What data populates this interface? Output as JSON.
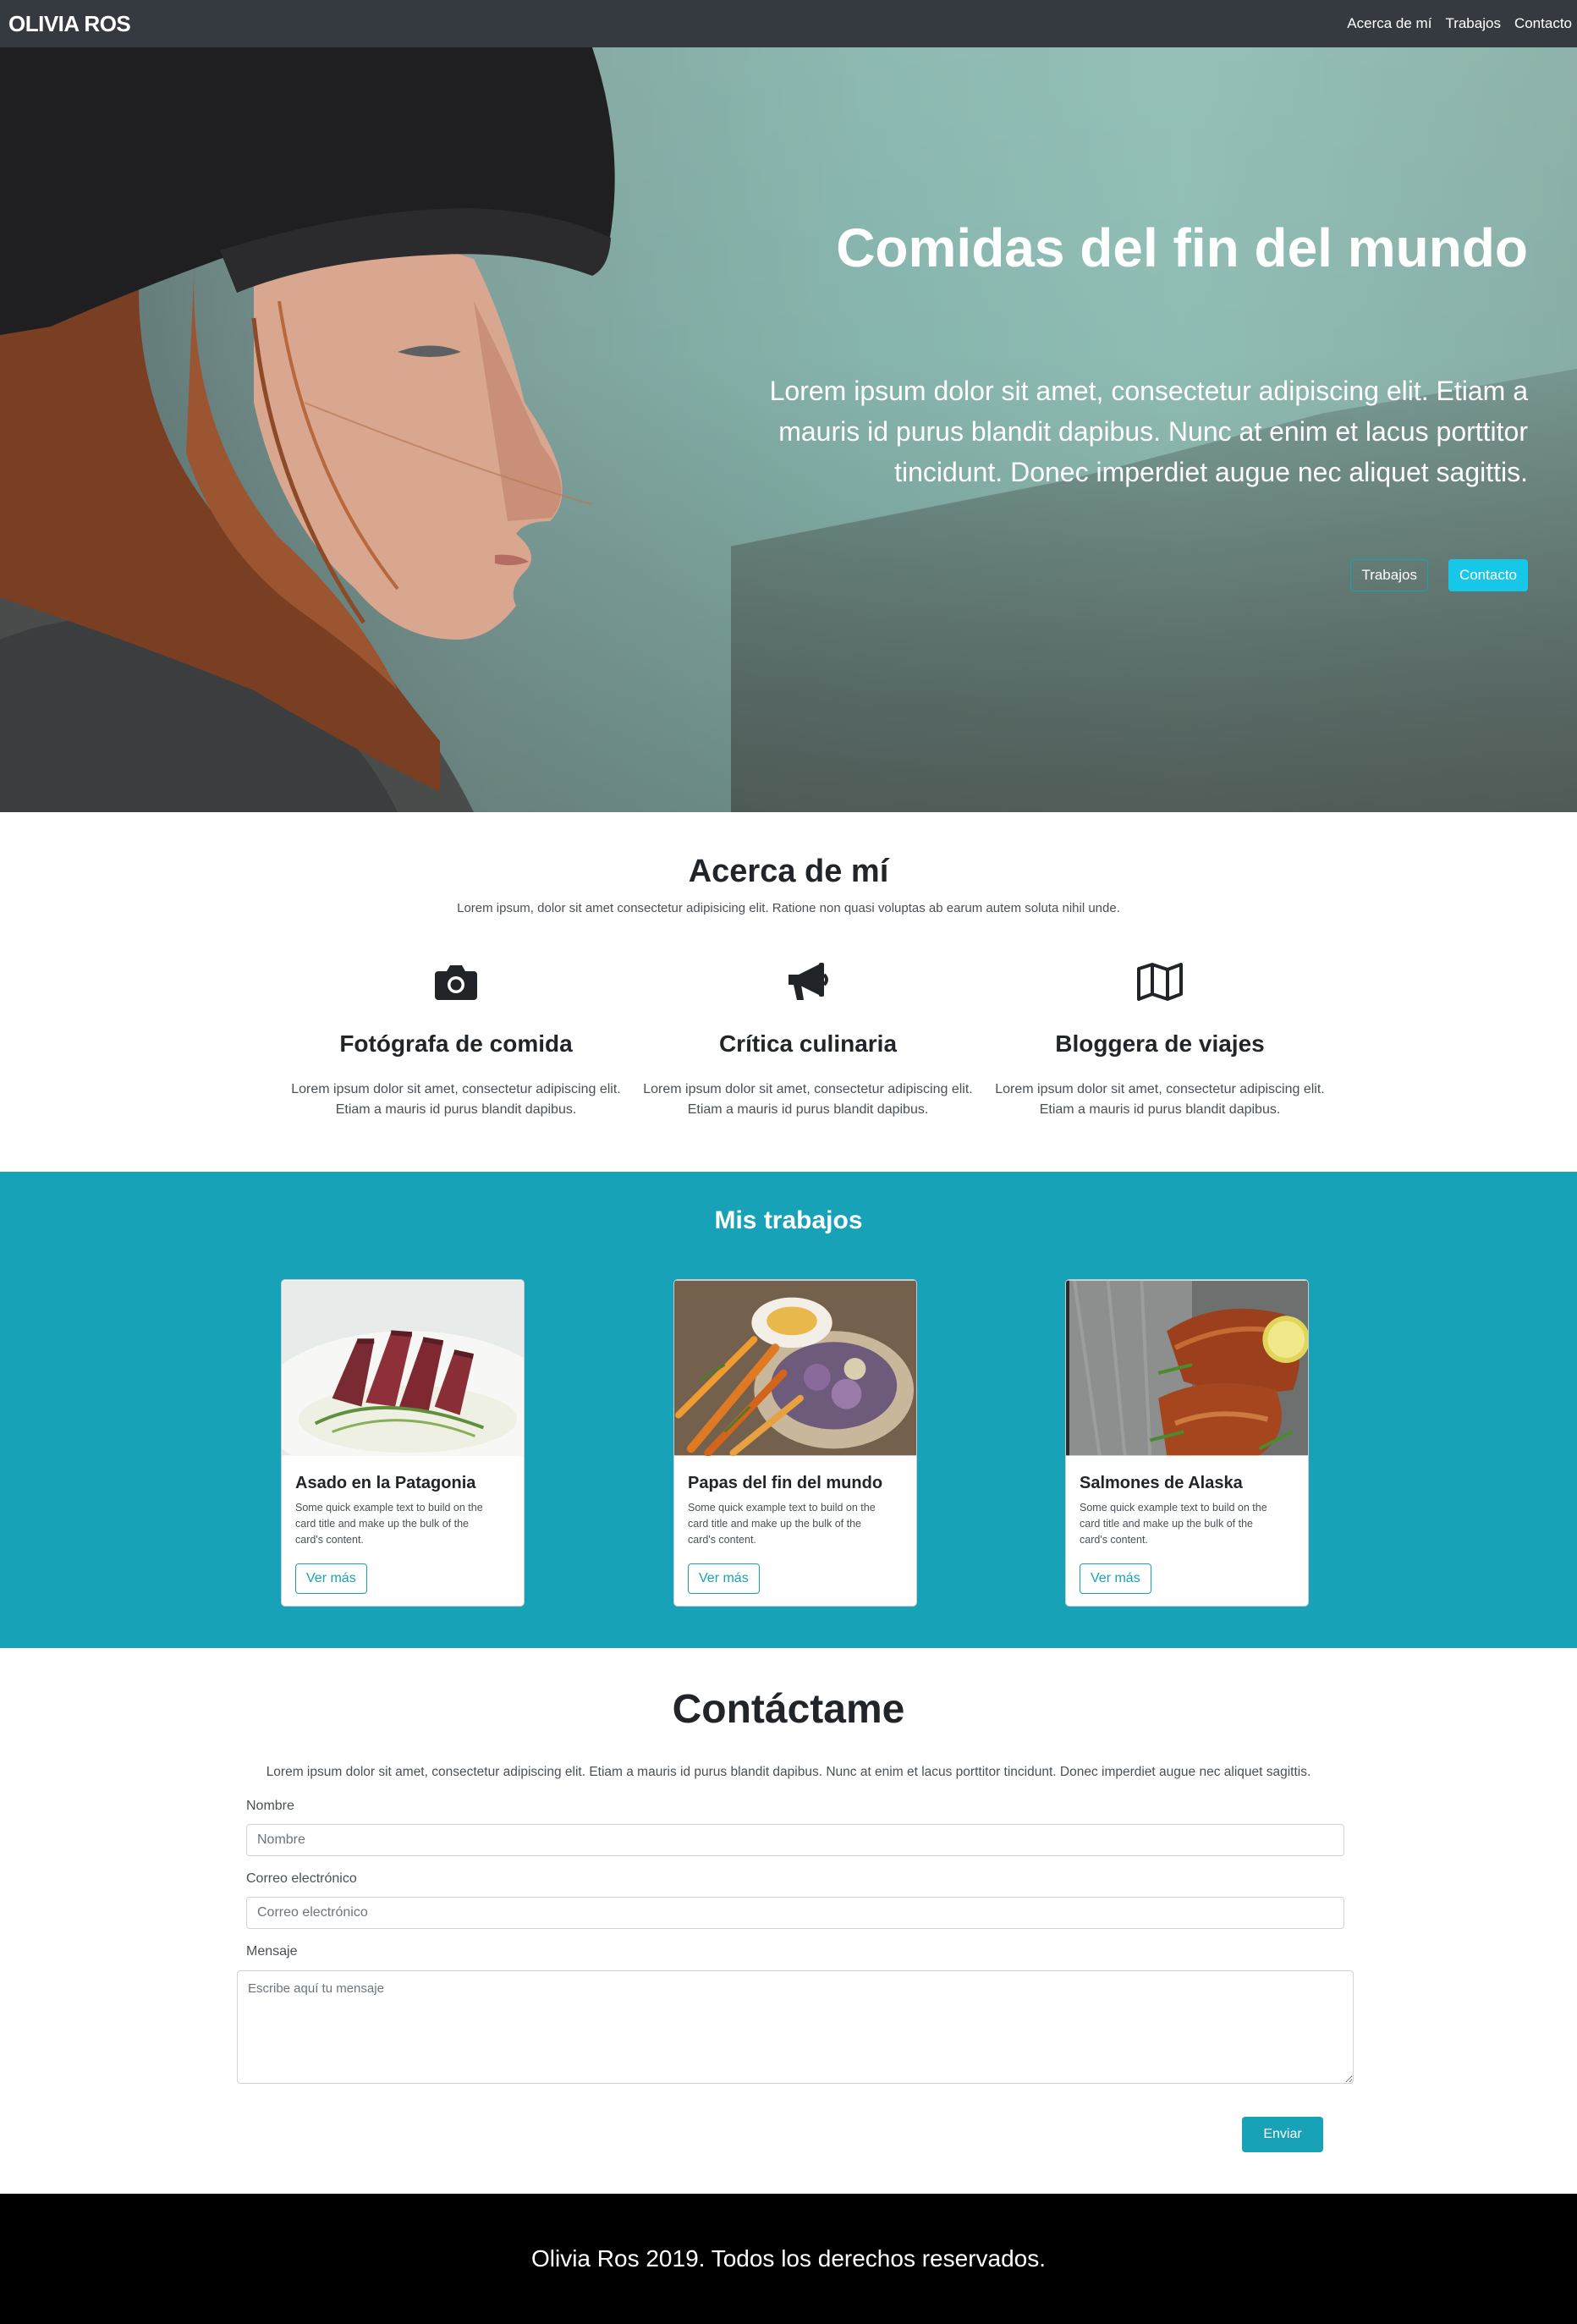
{
  "navbar": {
    "brand": "OLIVIA ROS",
    "links": [
      "Acerca de mí",
      "Trabajos",
      "Contacto"
    ]
  },
  "hero": {
    "title": "Comidas del fin del mundo",
    "lead": "Lorem ipsum dolor sit amet, consectetur adipiscing elit. Etiam a mauris id purus blandit dapibus. Nunc at enim et lacus porttitor tincidunt. Donec imperdiet augue nec aliquet sagittis.",
    "buttons": {
      "works": "Trabajos",
      "contact": "Contacto"
    }
  },
  "about": {
    "title": "Acerca de mí",
    "lead": "Lorem ipsum, dolor sit amet consectetur adipisicing elit. Ratione non quasi voluptas ab earum autem soluta nihil unde.",
    "features": [
      {
        "icon": "camera-icon",
        "title": "Fotógrafa de comida",
        "text": "Lorem ipsum dolor sit amet, consectetur adipiscing elit. Etiam a mauris id purus blandit dapibus."
      },
      {
        "icon": "bullhorn-icon",
        "title": "Crítica culinaria",
        "text": "Lorem ipsum dolor sit amet, consectetur adipiscing elit. Etiam a mauris id purus blandit dapibus."
      },
      {
        "icon": "map-icon",
        "title": "Bloggera de viajes",
        "text": "Lorem ipsum dolor sit amet, consectetur adipiscing elit. Etiam a mauris id purus blandit dapibus."
      }
    ]
  },
  "works": {
    "title": "Mis trabajos",
    "cards": [
      {
        "title": "Asado en la Patagonia",
        "text": "Some quick example text to build on the card title and make up the bulk of the card's content.",
        "button": "Ver más"
      },
      {
        "title": "Papas del fin del mundo",
        "text": "Some quick example text to build on the card title and make up the bulk of the card's content.",
        "button": "Ver más"
      },
      {
        "title": "Salmones de Alaska",
        "text": "Some quick example text to build on the card title and make up the bulk of the card's content.",
        "button": "Ver más"
      }
    ]
  },
  "contact": {
    "title": "Contáctame",
    "lead": "Lorem ipsum dolor sit amet, consectetur adipiscing elit. Etiam a mauris id purus blandit dapibus. Nunc at enim et lacus porttitor tincidunt. Donec imperdiet augue nec aliquet sagittis.",
    "name_label": "Nombre",
    "name_placeholder": "Nombre",
    "email_label": "Correo electrónico",
    "email_placeholder": "Correo electrónico",
    "message_label": "Mensaje",
    "message_placeholder": "Escribe aquí tu mensaje",
    "submit": "Enviar"
  },
  "footer": {
    "text": "Olivia Ros 2019. Todos los derechos reservados."
  },
  "colors": {
    "navbar": "#343a40",
    "info": "#17a2b8",
    "hero_button": "#17c7e8",
    "footer": "#000000"
  }
}
